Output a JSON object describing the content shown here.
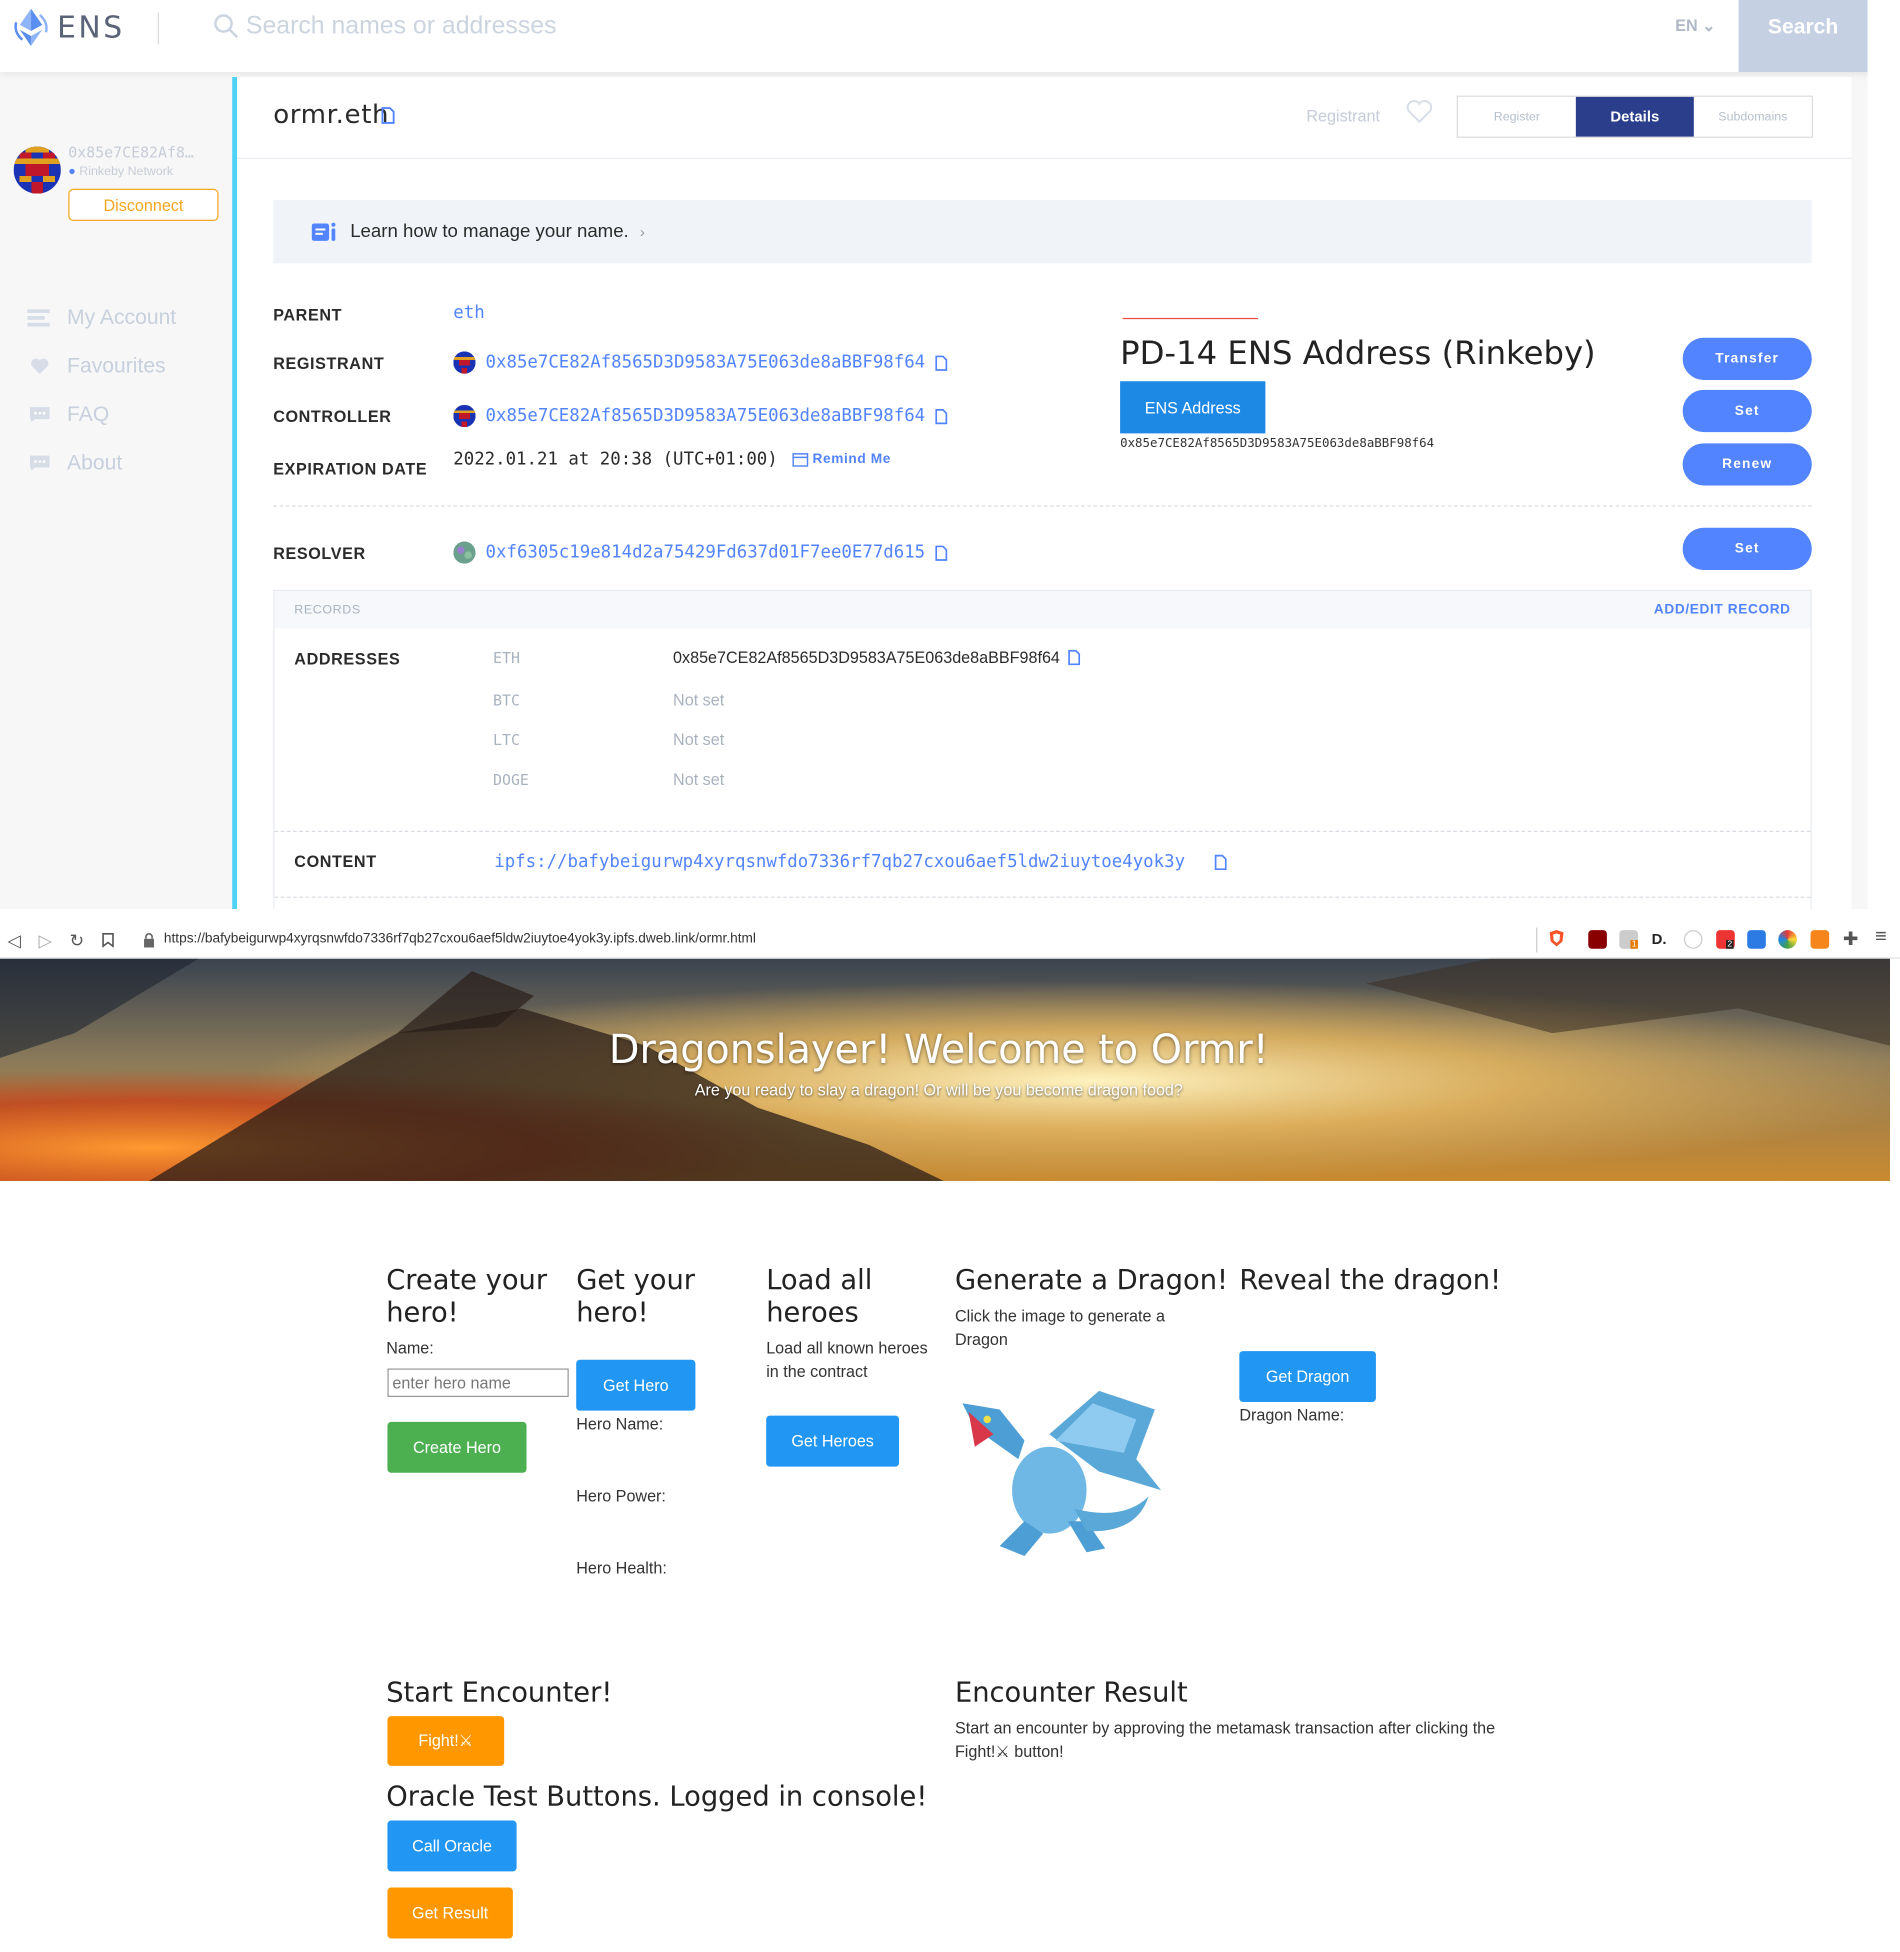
{
  "ens": {
    "logo_text": "ENS",
    "search_placeholder": "Search names or addresses",
    "language": "EN",
    "search_button": "Search",
    "account": {
      "address": "0x85e7CE82Af8…",
      "network": "Rinkeby Network",
      "disconnect": "Disconnect"
    },
    "nav": [
      "My Account",
      "Favourites",
      "FAQ",
      "About"
    ],
    "name": "ormr.eth",
    "registrant_label": "Registrant",
    "tabs": [
      "Register",
      "Details",
      "Subdomains"
    ],
    "learn": "Learn how to manage your name.",
    "details": {
      "parent_label": "PARENT",
      "parent_value": "eth",
      "registrant_label": "REGISTRANT",
      "registrant_value": "0x85e7CE82Af8565D3D9583A75E063de8aBBF98f64",
      "controller_label": "CONTROLLER",
      "controller_value": "0x85e7CE82Af8565D3D9583A75E063de8aBBF98f64",
      "expiration_label": "EXPIRATION DATE",
      "expiration_value": "2022.01.21 at 20:38 (UTC+01:00)",
      "remind": "Remind Me",
      "resolver_label": "RESOLVER",
      "resolver_value": "0xf6305c19e814d2a75429Fd637d01F7ee0E77d615"
    },
    "buttons": {
      "transfer": "Transfer",
      "set": "Set",
      "renew": "Renew",
      "resolver_set": "Set"
    },
    "pd": {
      "title": "PD-14 ENS Address (Rinkeby)",
      "button": "ENS Address",
      "address": "0x85e7CE82Af8565D3D9583A75E063de8aBBF98f64"
    },
    "records": {
      "header": "RECORDS",
      "edit": "ADD/EDIT RECORD",
      "addresses_label": "ADDRESSES",
      "coins": [
        {
          "coin": "ETH",
          "value": "0x85e7CE82Af8565D3D9583A75E063de8aBBF98f64"
        },
        {
          "coin": "BTC",
          "value": "Not set"
        },
        {
          "coin": "LTC",
          "value": "Not set"
        },
        {
          "coin": "DOGE",
          "value": "Not set"
        }
      ],
      "content_label": "CONTENT",
      "content_value": "ipfs://bafybeigurwp4xyrqsnwfdo7336rf7qb27cxou6aef5ldw2iuytoe4yok3y"
    }
  },
  "browser": {
    "url": "https://bafybeigurwp4xyrqsnwfdo7336rf7qb27cxou6aef5ldw2iuytoe4yok3y.ipfs.dweb.link/ormr.html",
    "badges": [
      "1",
      "2"
    ]
  },
  "game": {
    "title": "Dragonslayer! Welcome to Ormr!",
    "subtitle": "Are you ready to slay a dragon! Or will be you become dragon food?",
    "create": {
      "heading_1": "Create your",
      "heading_2": "hero!",
      "name_label": "Name:",
      "placeholder": "enter hero name",
      "button": "Create Hero"
    },
    "get": {
      "heading_1": "Get your",
      "heading_2": "hero!",
      "button": "Get Hero",
      "hero_name": "Hero Name:",
      "hero_power": "Hero Power:",
      "hero_health": "Hero Health:"
    },
    "load": {
      "heading_1": "Load all",
      "heading_2": "heroes",
      "text_1": "Load all known heroes",
      "text_2": "in the contract",
      "button": "Get Heroes"
    },
    "generate": {
      "heading": "Generate a Dragon!",
      "text_1": "Click the image to generate a",
      "text_2": "Dragon"
    },
    "reveal": {
      "heading": "Reveal the dragon!",
      "button": "Get Dragon",
      "dragon_name": "Dragon Name:"
    },
    "encounter": {
      "heading": "Start Encounter!",
      "button": "Fight!⚔"
    },
    "result": {
      "heading": "Encounter Result",
      "text_1": "Start an encounter by approving the metamask transaction after clicking the",
      "text_2": "Fight!⚔ button!"
    },
    "oracle": {
      "heading": "Oracle Test Buttons. Logged in console!",
      "call": "Call Oracle",
      "get": "Get Result"
    }
  }
}
